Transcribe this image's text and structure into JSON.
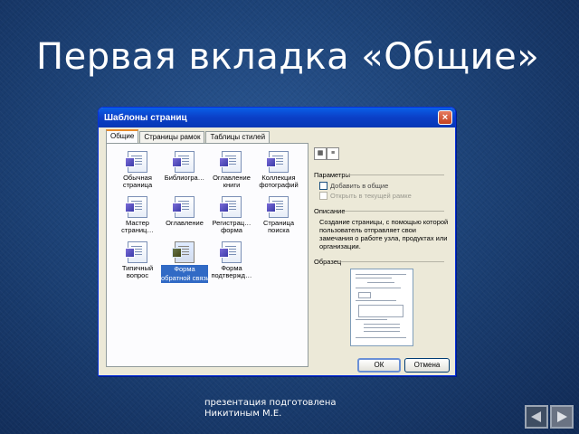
{
  "slide": {
    "title": "Первая вкладка «Общие»"
  },
  "dialog": {
    "title": "Шаблоны страниц",
    "close_glyph": "×",
    "tabs": [
      {
        "label": "Общие",
        "active": true
      },
      {
        "label": "Страницы рамок",
        "active": false
      },
      {
        "label": "Таблицы стилей",
        "active": false
      }
    ],
    "templates": [
      {
        "label1": "Обычная",
        "label2": "страница"
      },
      {
        "label1": "Библиогра…",
        "label2": ""
      },
      {
        "label1": "Оглавление",
        "label2": "книги"
      },
      {
        "label1": "Коллекция",
        "label2": "фотографий"
      },
      {
        "label1": "Мастер",
        "label2": "страниц…"
      },
      {
        "label1": "Оглавление",
        "label2": ""
      },
      {
        "label1": "Регистрац…",
        "label2": "форма"
      },
      {
        "label1": "Страница",
        "label2": "поиска"
      },
      {
        "label1": "Типичный",
        "label2": "вопрос"
      },
      {
        "label1": "Форма",
        "label2": "обратной связи"
      },
      {
        "label1": "Форма",
        "label2": "подтвержд…"
      }
    ],
    "selected_template_index": 9,
    "view_buttons": [
      "large-icons-icon",
      "list-view-icon"
    ],
    "options": {
      "label": "Параметры",
      "checkbox1": "Добавить в общие",
      "checkbox2": "Открыть в текущей рамке"
    },
    "description": {
      "label": "Описание",
      "text": "Создание страницы, с помощью которой пользователь отправляет свои замечания о работе узла, продуктах или организации."
    },
    "preview": {
      "label": "Образец"
    },
    "buttons": {
      "ok": "ОК",
      "cancel": "Отмена"
    }
  },
  "credit": {
    "line1": "презентация подготовлена",
    "line2": "Никитиным М.Е."
  }
}
